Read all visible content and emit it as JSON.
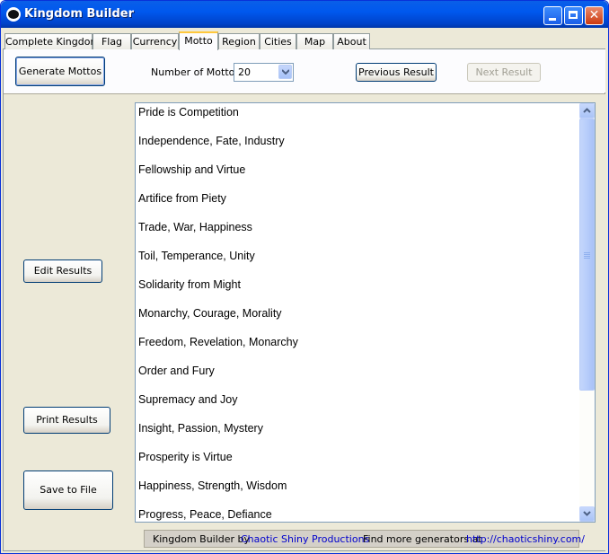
{
  "window": {
    "title": "Kingdom Builder",
    "icon": "skull-icon",
    "controls": [
      "minimize-icon",
      "maximize-icon",
      "close-icon"
    ]
  },
  "tabs": [
    {
      "label": "Complete Kingdom"
    },
    {
      "label": "Flag"
    },
    {
      "label": "Currency"
    },
    {
      "label": "Motto",
      "active": true
    },
    {
      "label": "Region"
    },
    {
      "label": "Cities"
    },
    {
      "label": "Map"
    },
    {
      "label": "About"
    }
  ],
  "toolbar": {
    "generate_label": "Generate Mottos",
    "count_label": "Number of Mottos:",
    "count_value": "20",
    "previous_label": "Previous Result",
    "next_label": "Next Result"
  },
  "side_buttons": {
    "edit_label": "Edit Results",
    "print_label": "Print Results",
    "save_label": "Save to File"
  },
  "results": [
    "Pride is Competition",
    "Independence, Fate, Industry",
    "Fellowship and Virtue",
    "Artifice from Piety",
    "Trade, War, Happiness",
    "Toil, Temperance, Unity",
    "Solidarity from Might",
    "Monarchy, Courage, Morality",
    "Freedom, Revelation, Monarchy",
    "Order and Fury",
    "Supremacy and Joy",
    "Insight, Passion, Mystery",
    "Prosperity is Virtue",
    "Happiness, Strength, Wisdom",
    "Progress, Peace, Defiance"
  ],
  "footer": {
    "prefix": "Kingdom Builder by",
    "author_link": "Chaotic Shiny Productions",
    "more_text": "Find more generators at",
    "url_link": "http://chaoticshiny.com/"
  },
  "colors": {
    "titlebar": "#0058ee",
    "link": "#0000cc",
    "active_tab_accent": "#ffc83c"
  }
}
